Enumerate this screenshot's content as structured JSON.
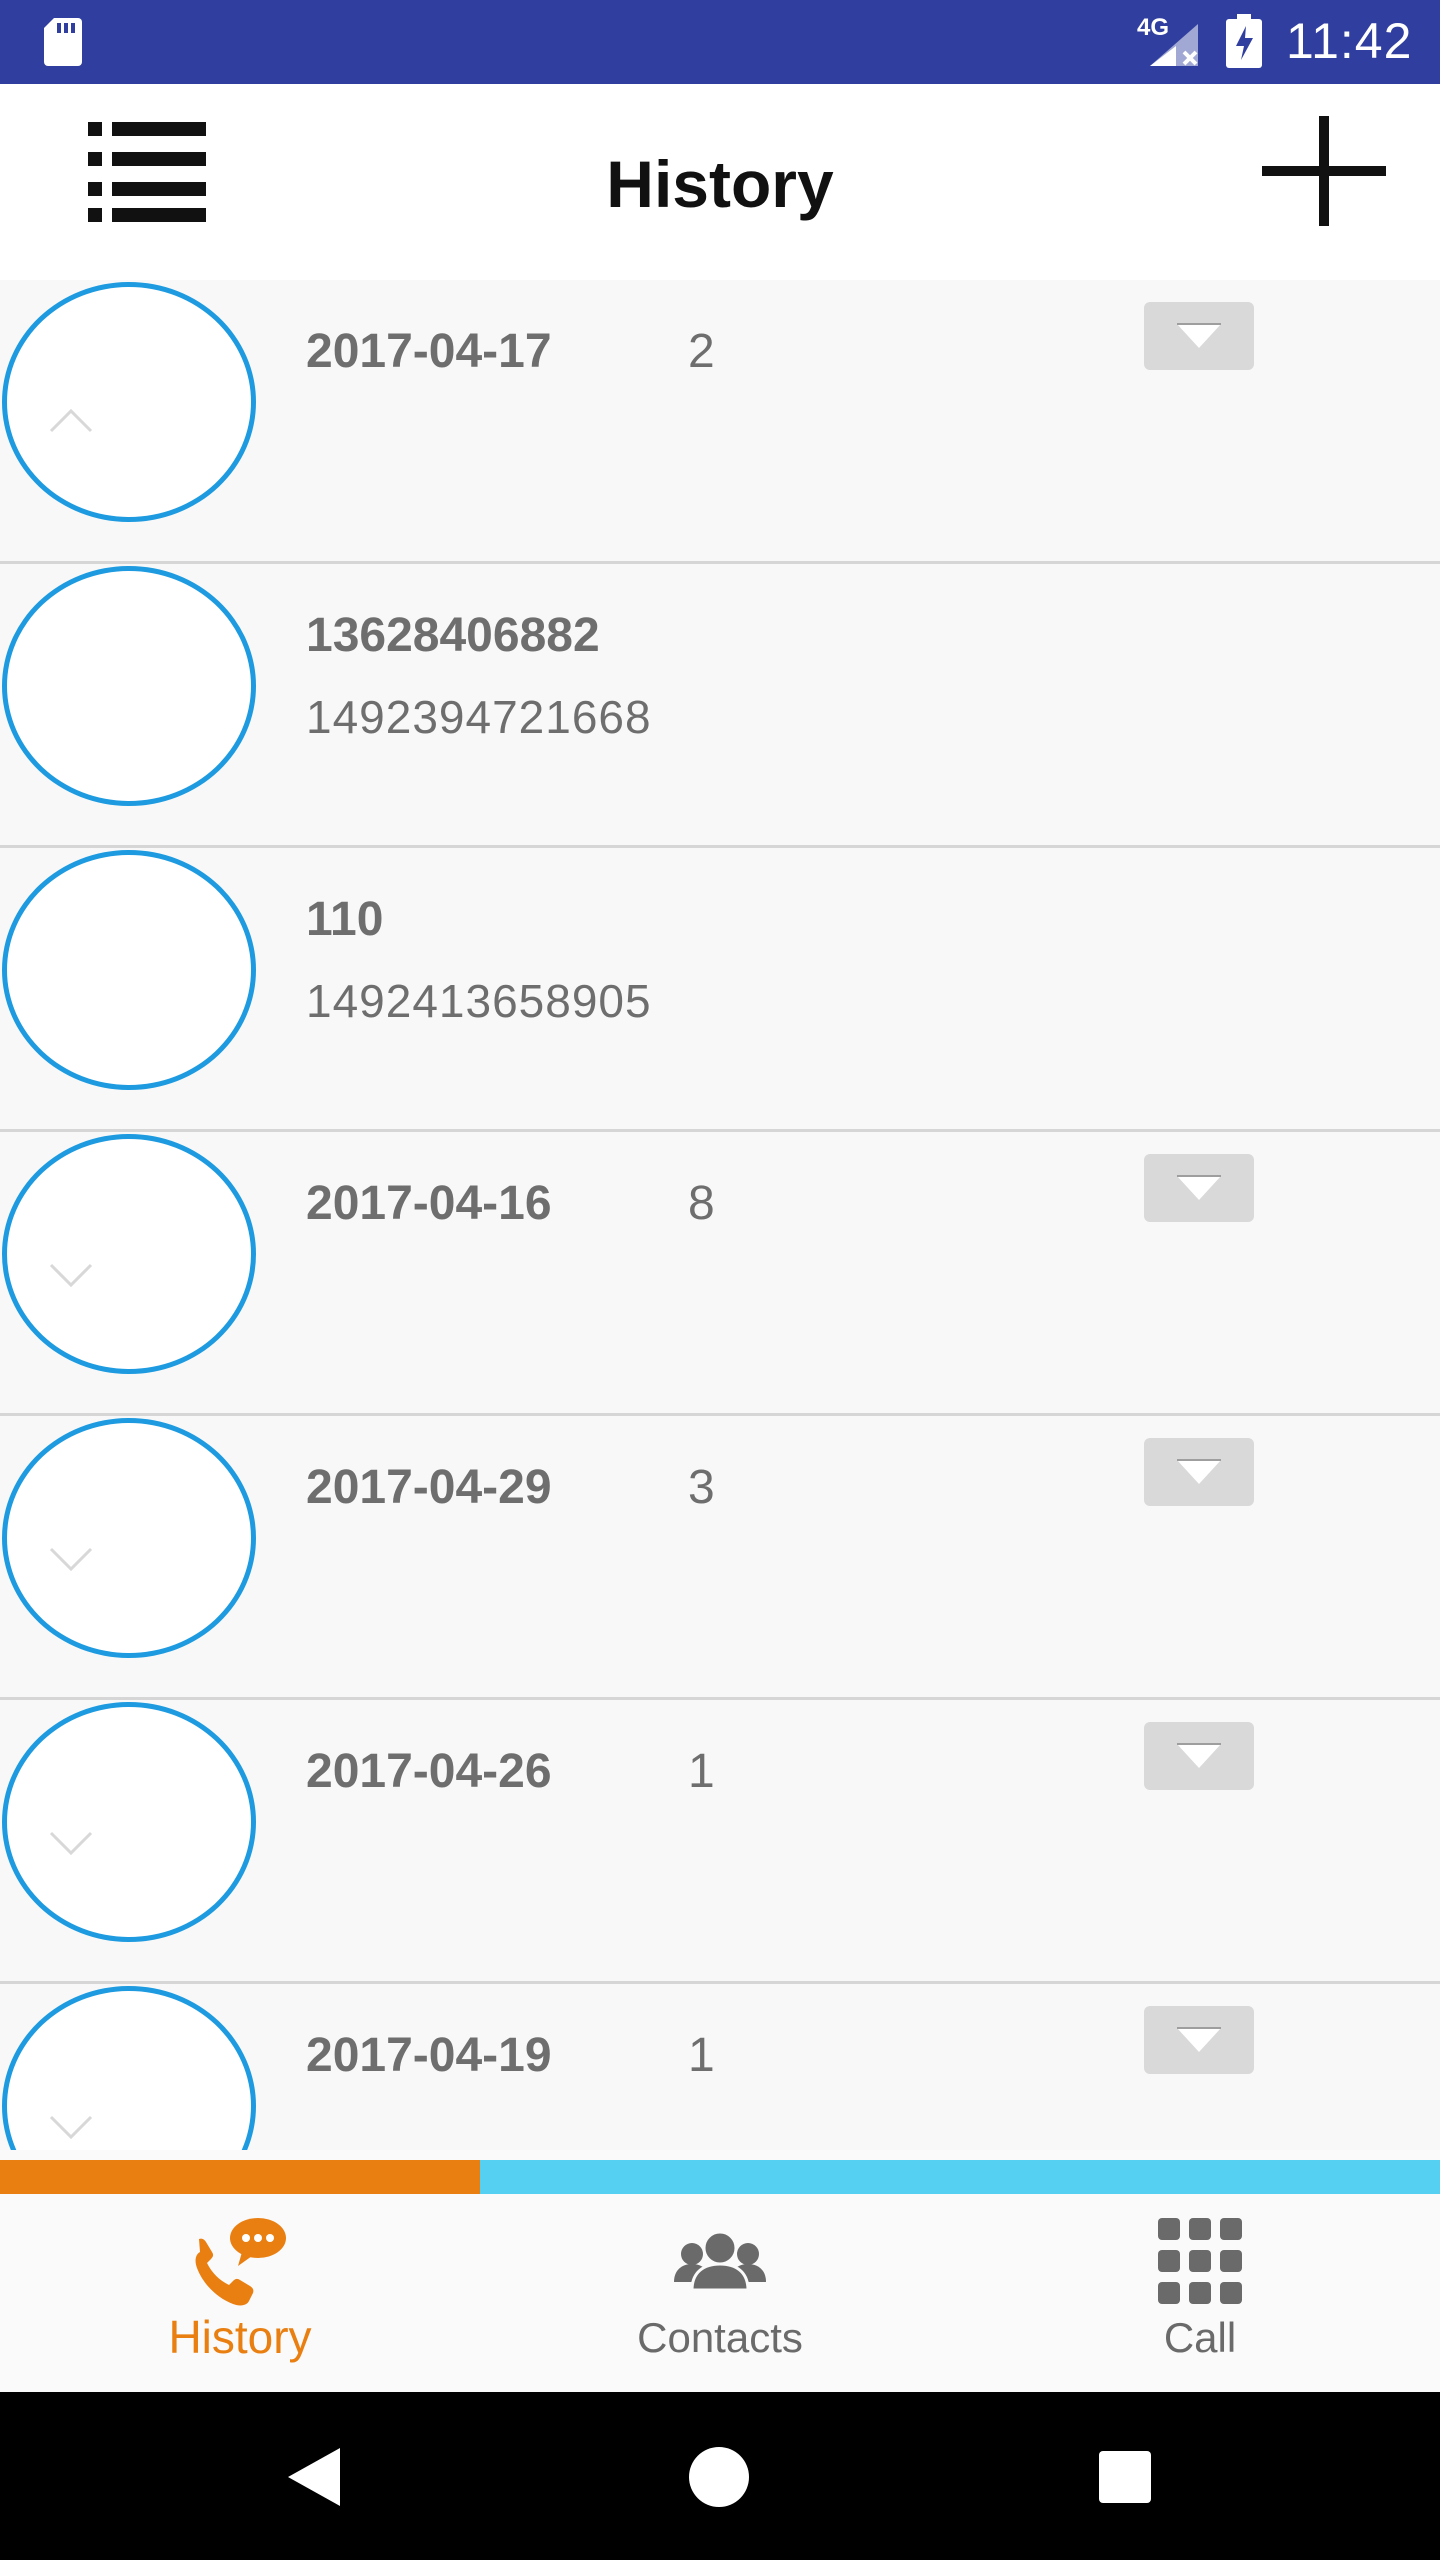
{
  "status_bar": {
    "network": "4G",
    "time": "11:42",
    "icons": [
      "sd-card-icon",
      "signal-icon",
      "battery-charging-icon"
    ]
  },
  "toolbar": {
    "title": "History",
    "left_icon": "list-menu-icon",
    "right_icon": "plus-icon"
  },
  "history": {
    "items": [
      {
        "type": "group",
        "title": "2017-04-17",
        "count": "2",
        "expanded": true
      },
      {
        "type": "entry",
        "title": "13628406882",
        "subtitle": "1492394721668"
      },
      {
        "type": "entry",
        "title": "110",
        "subtitle": "1492413658905"
      },
      {
        "type": "group",
        "title": "2017-04-16",
        "count": "8",
        "expanded": false
      },
      {
        "type": "group",
        "title": "2017-04-29",
        "count": "3",
        "expanded": false
      },
      {
        "type": "group",
        "title": "2017-04-26",
        "count": "1",
        "expanded": false
      },
      {
        "type": "group",
        "title": "2017-04-19",
        "count": "1",
        "expanded": false
      }
    ]
  },
  "bottom_nav": {
    "items": [
      {
        "label": "History",
        "icon": "phone-chat-icon",
        "active": true
      },
      {
        "label": "Contacts",
        "icon": "contacts-group-icon",
        "active": false
      },
      {
        "label": "Call",
        "icon": "dialpad-icon",
        "active": false
      }
    ]
  },
  "colors": {
    "status_bar": "#303f9f",
    "accent": "#e97f11",
    "tab_inactive": "#55d0f3",
    "avatar_ring": "#1e9be0",
    "text_secondary": "#6e6e6e"
  }
}
